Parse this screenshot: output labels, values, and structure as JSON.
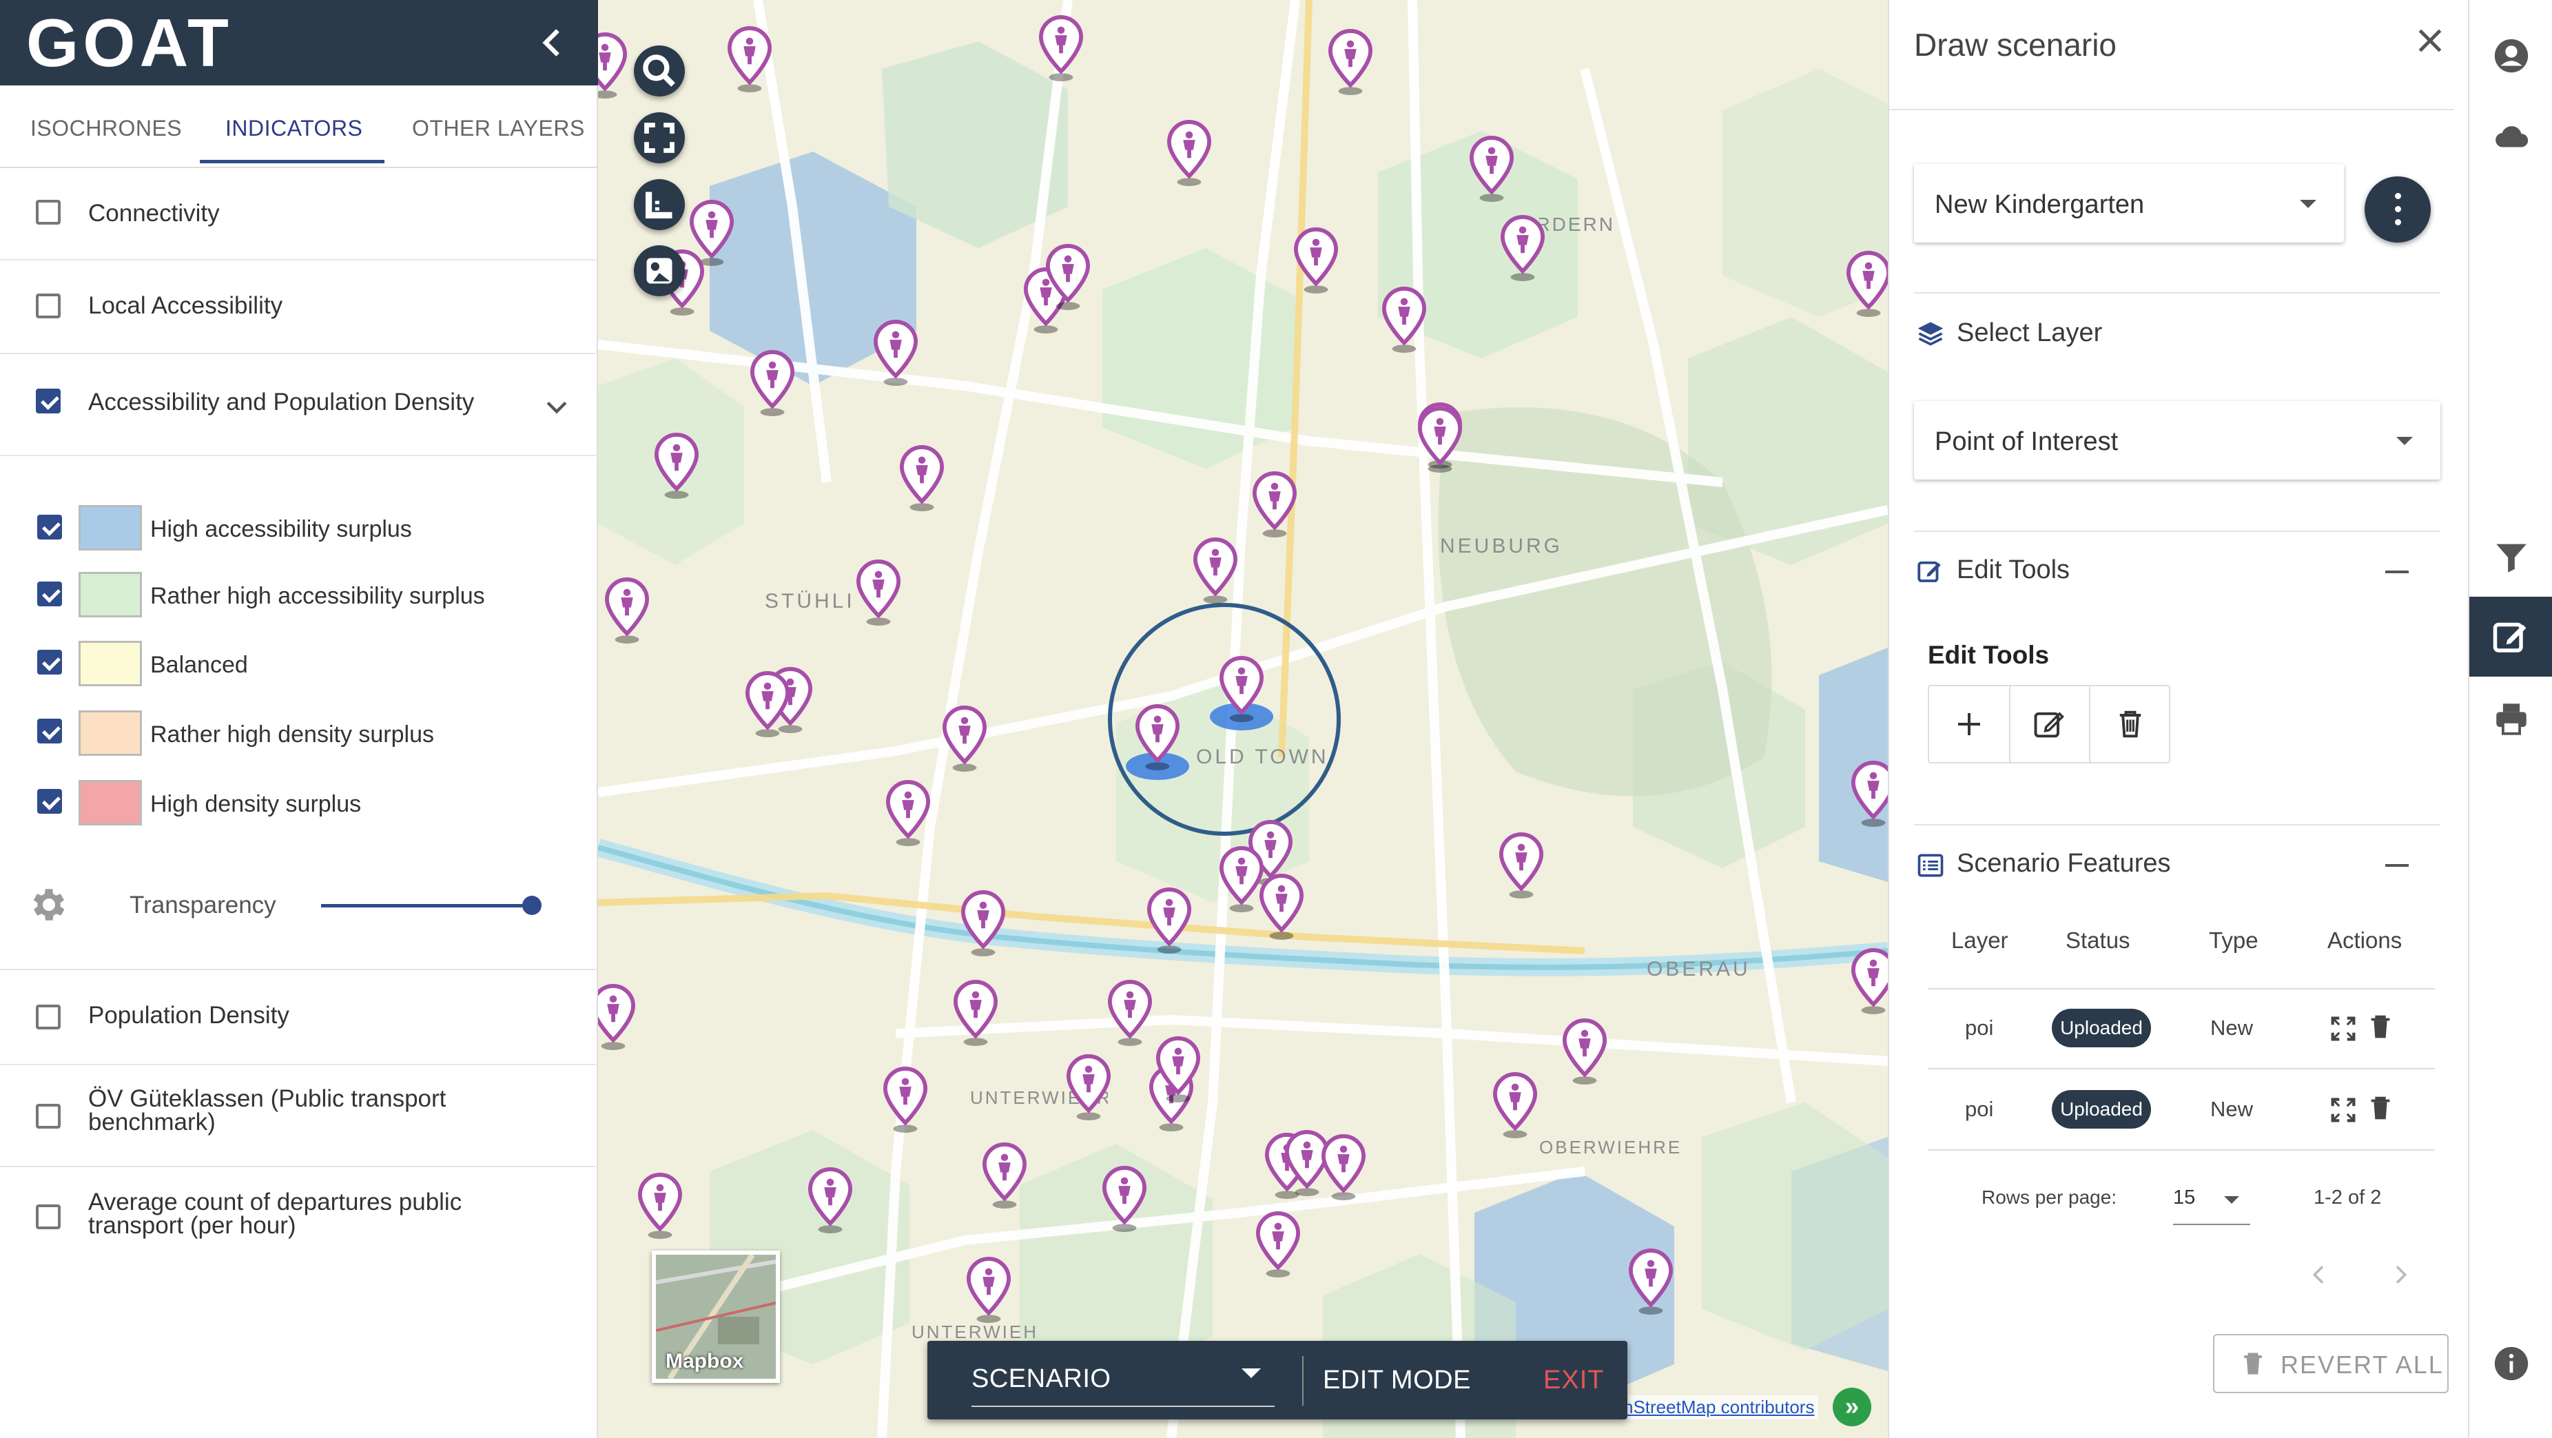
{
  "app": {
    "logo": "GOAT"
  },
  "left_panel": {
    "tabs": [
      {
        "label": "ISOCHRONES",
        "active": false
      },
      {
        "label": "INDICATORS",
        "active": true
      },
      {
        "label": "OTHER LAYERS",
        "active": false
      }
    ],
    "layers": [
      {
        "label": "Connectivity",
        "checked": false
      },
      {
        "label": "Local Accessibility",
        "checked": false
      },
      {
        "label": "Accessibility and Population Density",
        "checked": true,
        "expanded": true
      }
    ],
    "legend": [
      {
        "label": "High accessibility surplus",
        "color": "#a9cbe8",
        "checked": true
      },
      {
        "label": "Rather high accessibility surplus",
        "color": "#d9efd4",
        "checked": true
      },
      {
        "label": "Balanced",
        "color": "#fdfbd6",
        "checked": true
      },
      {
        "label": "Rather high density surplus",
        "color": "#fde0c3",
        "checked": true
      },
      {
        "label": "High density surplus",
        "color": "#f2a6a8",
        "checked": true
      }
    ],
    "transparency_label": "Transparency",
    "transparency_value": 1.0,
    "more_layers": [
      {
        "label": "Population Density",
        "checked": false
      },
      {
        "label": "ÖV Güteklassen (Public transport benchmark)",
        "checked": false
      },
      {
        "label": "Average count of departures public transport (per hour)",
        "checked": false
      }
    ]
  },
  "map": {
    "place_labels": [
      "STÜHLINGER",
      "NEUBURG",
      "OLD TOWN",
      "OBERAU",
      "OBERWIEHRE",
      "UNTERWIEHRE-NORD",
      "HERDERN",
      "UNTERWIEHRE"
    ],
    "mapbox_label": "Mapbox",
    "attribution": "nStreetMap contributors",
    "attribution_toggle": "»"
  },
  "scenario_bar": {
    "select_value": "SCENARIO",
    "edit_mode_label": "EDIT MODE",
    "exit_label": "EXIT"
  },
  "right_panel": {
    "title": "Draw scenario",
    "scenario_select": "New Kindergarten",
    "select_layer_heading": "Select Layer",
    "layer_select": "Point of Interest",
    "edit_tools_heading": "Edit Tools",
    "edit_tools_subheading": "Edit Tools",
    "scenario_features_heading": "Scenario Features",
    "table": {
      "headers": [
        "Layer",
        "Status",
        "Type",
        "Actions"
      ],
      "rows": [
        {
          "layer": "poi",
          "status": "Uploaded",
          "type": "New"
        },
        {
          "layer": "poi",
          "status": "Uploaded",
          "type": "New"
        }
      ]
    },
    "rows_per_page_label": "Rows per page:",
    "rows_per_page": "15",
    "page_range": "1-2 of 2",
    "revert_all_label": "REVERT ALL"
  },
  "colors": {
    "brand_dark": "#2b3a4a",
    "accent_blue": "#2f4b8c",
    "poi_pink": "#a74ea8",
    "exit_red": "#e35656"
  }
}
